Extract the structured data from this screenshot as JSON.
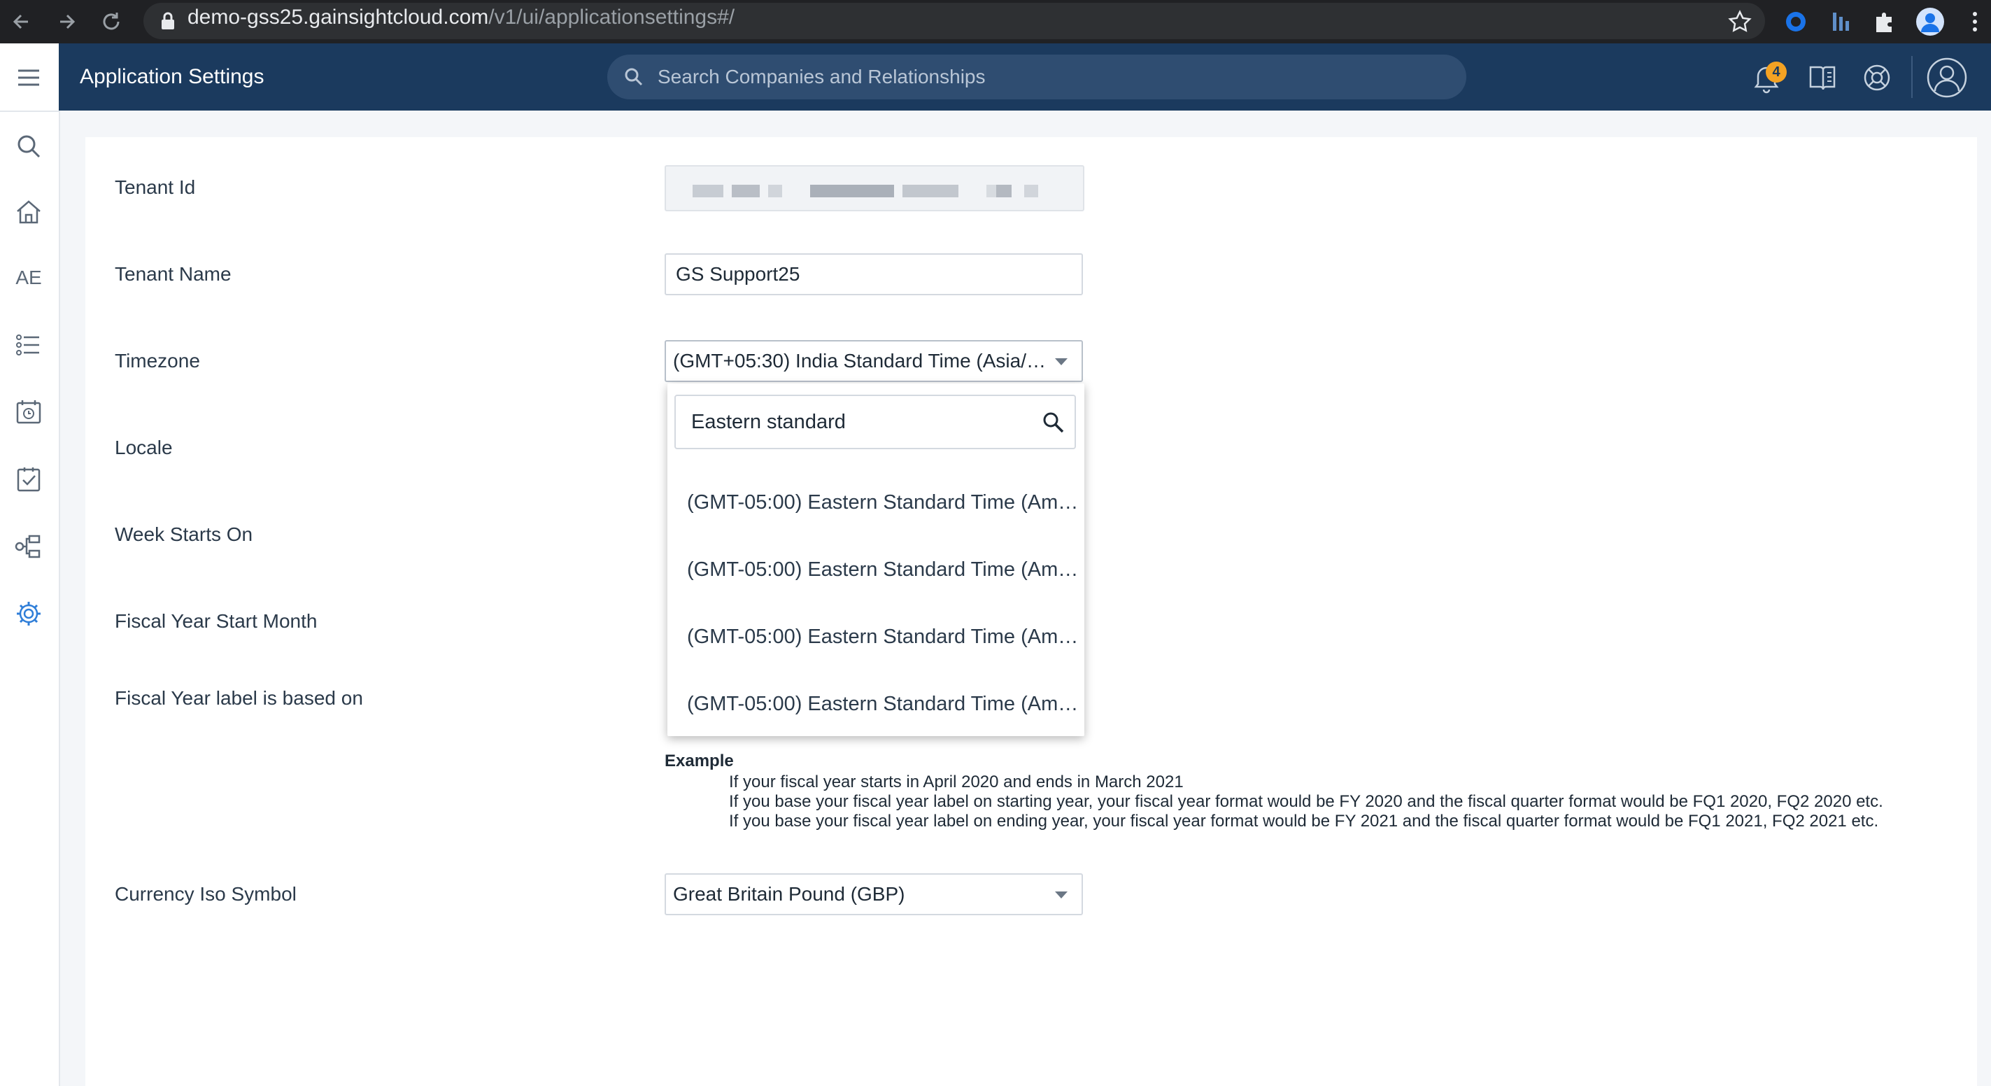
{
  "browser": {
    "url_host": "demo-gss25.gainsightcloud.com",
    "url_path": "/v1/ui/applicationsettings#/"
  },
  "header": {
    "title": "Application Settings",
    "search_placeholder": "Search Companies and Relationships",
    "notification_count": "4"
  },
  "rail": {
    "ae_label": "AE"
  },
  "form": {
    "tenant_id_label": "Tenant Id",
    "tenant_name_label": "Tenant Name",
    "tenant_name_value": "GS Support25",
    "timezone_label": "Timezone",
    "timezone_value": "(GMT+05:30) India Standard Time (Asia/…",
    "locale_label": "Locale",
    "week_starts_label": "Week Starts On",
    "fiscal_start_label": "Fiscal Year Start Month",
    "fiscal_label_basis_label": "Fiscal Year label is based on",
    "currency_label": "Currency Iso Symbol",
    "currency_value": "Great Britain Pound (GBP)"
  },
  "example": {
    "title": "Example",
    "lines": [
      "If your fiscal year starts in April 2020 and ends in March 2021",
      "If you base your fiscal year label on starting year, your fiscal year format would be FY 2020 and the fiscal quarter format would be FQ1 2020, FQ2 2020 etc.",
      "If you base your fiscal year label on ending year, your fiscal year format would be FY 2021 and the fiscal quarter format would be FQ1 2021, FQ2 2021 etc."
    ]
  },
  "timezone_dropdown": {
    "search_value": "Eastern standard",
    "options": [
      "(GMT-05:00) Eastern Standard Time (Am…",
      "(GMT-05:00) Eastern Standard Time (Am…",
      "(GMT-05:00) Eastern Standard Time (Am…",
      "(GMT-05:00) Eastern Standard Time (Am…"
    ]
  },
  "colors": {
    "header_bg": "#1b3a5e",
    "accent": "#2f7ed8",
    "badge": "#f4a223"
  }
}
